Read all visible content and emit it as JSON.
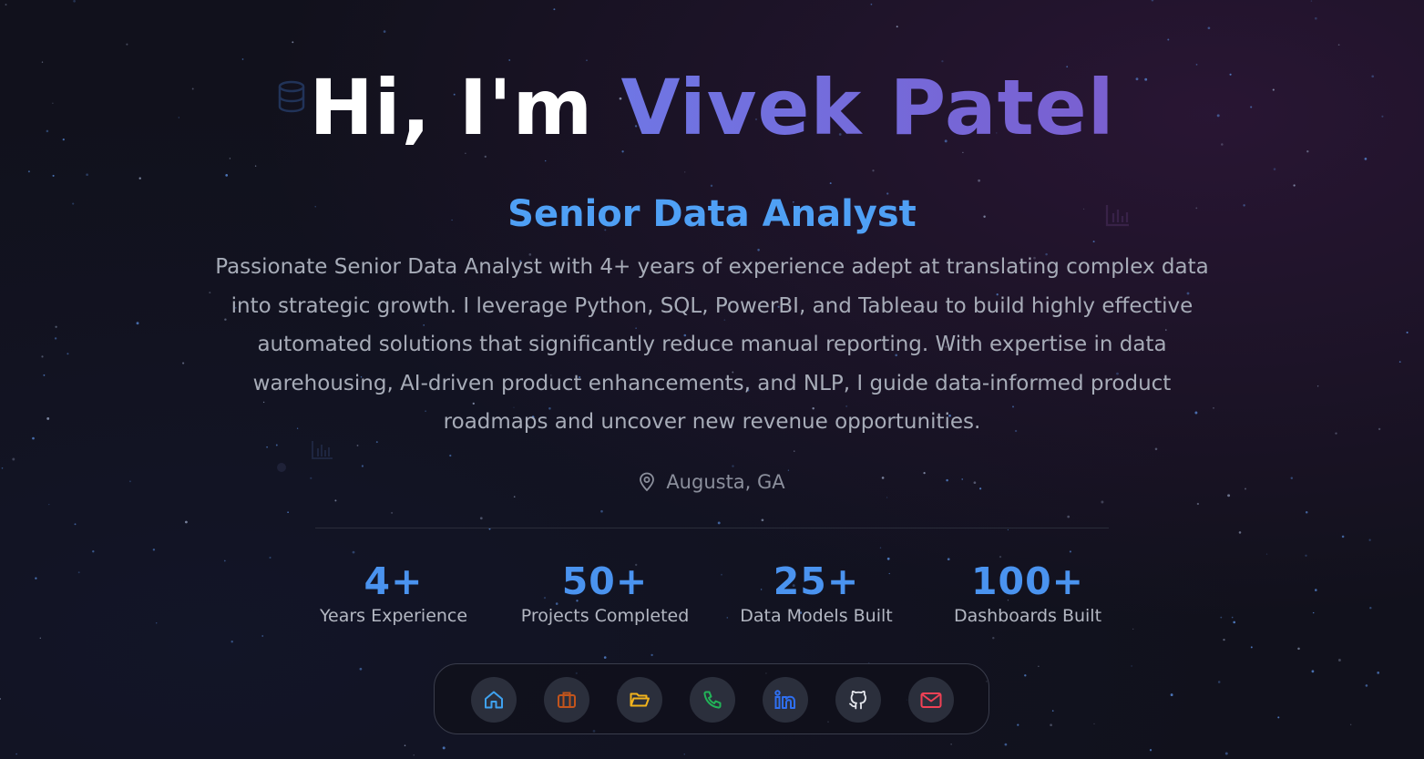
{
  "hero": {
    "greeting": "Hi, I'm",
    "name": "Vivek Patel",
    "role": "Senior Data Analyst",
    "bio": "Passionate Senior Data Analyst with 4+ years of experience adept at translating complex data into strategic growth. I leverage Python, SQL, PowerBI, and Tableau to build highly effective automated solutions that significantly reduce manual reporting. With expertise in data warehousing, AI-driven product enhancements, and NLP, I guide data-informed product roadmaps and uncover new revenue opportunities.",
    "location": "Augusta, GA"
  },
  "stats": [
    {
      "value": "4+",
      "label": "Years Experience"
    },
    {
      "value": "50+",
      "label": "Projects Completed"
    },
    {
      "value": "25+",
      "label": "Data Models Built"
    },
    {
      "value": "100+",
      "label": "Dashboards Built"
    }
  ],
  "dock": [
    {
      "icon": "home-icon",
      "color": "#3fa2f0"
    },
    {
      "icon": "briefcase-icon",
      "color": "#c2541c"
    },
    {
      "icon": "folder-icon",
      "color": "#f2b31c"
    },
    {
      "icon": "phone-icon",
      "color": "#22b358"
    },
    {
      "icon": "linkedin-icon",
      "color": "#2f6ff0"
    },
    {
      "icon": "github-icon",
      "color": "#e6e8ee"
    },
    {
      "icon": "mail-icon",
      "color": "#f04155"
    }
  ],
  "colors": {
    "accent_blue": "#4fa0f5",
    "name_gradient_start": "#6f76e4",
    "name_gradient_end": "#7a5fd0",
    "background": "#11111c"
  }
}
